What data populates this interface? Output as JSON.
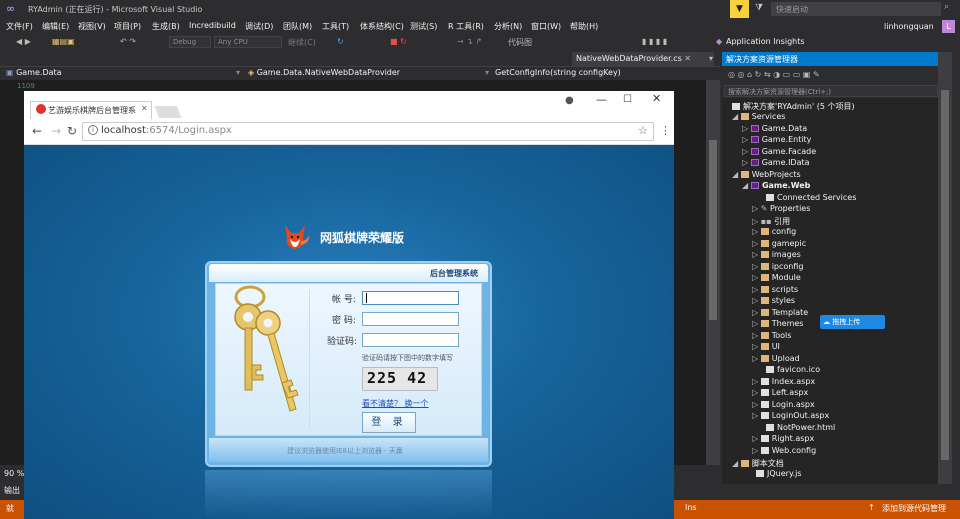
{
  "vs": {
    "title": "RYAdmin (正在运行) - Microsoft Visual Studio",
    "quick_launch_placeholder": "快速启动",
    "user": "linhongquan",
    "avatar_letter": "L",
    "menu": [
      "文件(F)",
      "编辑(E)",
      "视图(V)",
      "项目(P)",
      "生成(B)",
      "Incredibuild",
      "调试(D)",
      "团队(M)",
      "工具(T)",
      "体系结构(C)",
      "测试(S)",
      "R 工具(R)",
      "分析(N)",
      "窗口(W)",
      "帮助(H)"
    ],
    "toolbar": {
      "config": "Debug",
      "platform": "Any CPU",
      "continue": "继续(C)",
      "code_map": "代码图",
      "app_insights": "Application Insights"
    },
    "active_tab": "NativeWebDataProvider.cs",
    "nav": {
      "project": "Game.Data",
      "type": "Game.Data.NativeWebDataProvider",
      "member": "GetConfigInfo(string configKey)"
    },
    "line_number": "1109",
    "zoom": "90 %",
    "output_label": "输出",
    "status": {
      "ins": "Ins",
      "source_control": "添加到源代码管理",
      "left_icon_text": "就"
    }
  },
  "browser": {
    "tab_title": "艺游娱乐棋牌后台管理系",
    "url_host": "localhost",
    "url_rest": ":6574/Login.aspx"
  },
  "login": {
    "logo_text": "网狐棋牌荣耀版",
    "panel_title": "后台管理系统",
    "account_label": "帐  号:",
    "password_label": "密  码:",
    "captcha_label": "验证码:",
    "captcha_hint": "验证码请按下图中的数字填写",
    "captcha_value": "225 42",
    "captcha_link": "看不清楚？ 换一个",
    "login_button": "登 录",
    "footer": "建议浏览器使用IE8以上浏览器 - 天赢"
  },
  "solution_explorer": {
    "title": "解决方案资源管理器",
    "search_placeholder": "搜索解决方案资源管理器(Ctrl+;)",
    "items": [
      {
        "label": "解决方案'RYAdmin' (5 个项目)",
        "indent": 0,
        "kind": "solution"
      },
      {
        "label": "Services",
        "indent": 1,
        "kind": "folder"
      },
      {
        "label": "Game.Data",
        "indent": 2,
        "kind": "project"
      },
      {
        "label": "Game.Entity",
        "indent": 2,
        "kind": "project"
      },
      {
        "label": "Game.Facade",
        "indent": 2,
        "kind": "project"
      },
      {
        "label": "Game.IData",
        "indent": 2,
        "kind": "project"
      },
      {
        "label": "WebProjects",
        "indent": 1,
        "kind": "folder"
      },
      {
        "label": "Game.Web",
        "indent": 2,
        "kind": "project"
      },
      {
        "label": "Connected Services",
        "indent": 3,
        "kind": "file"
      },
      {
        "label": "Properties",
        "indent": 3,
        "kind": "file"
      },
      {
        "label": "引用",
        "indent": 3,
        "kind": "file"
      },
      {
        "label": "config",
        "indent": 3,
        "kind": "folder"
      },
      {
        "label": "gamepic",
        "indent": 3,
        "kind": "folder"
      },
      {
        "label": "images",
        "indent": 3,
        "kind": "folder"
      },
      {
        "label": "ipconfig",
        "indent": 3,
        "kind": "folder"
      },
      {
        "label": "Module",
        "indent": 3,
        "kind": "folder"
      },
      {
        "label": "scripts",
        "indent": 3,
        "kind": "folder"
      },
      {
        "label": "styles",
        "indent": 3,
        "kind": "folder"
      },
      {
        "label": "Template",
        "indent": 3,
        "kind": "folder"
      },
      {
        "label": "Themes",
        "indent": 3,
        "kind": "folder"
      },
      {
        "label": "Tools",
        "indent": 3,
        "kind": "folder"
      },
      {
        "label": "UI",
        "indent": 3,
        "kind": "folder"
      },
      {
        "label": "Upload",
        "indent": 3,
        "kind": "folder"
      },
      {
        "label": "favicon.ico",
        "indent": 3,
        "kind": "file"
      },
      {
        "label": "Index.aspx",
        "indent": 3,
        "kind": "file"
      },
      {
        "label": "Left.aspx",
        "indent": 3,
        "kind": "file"
      },
      {
        "label": "Login.aspx",
        "indent": 3,
        "kind": "file"
      },
      {
        "label": "LoginOut.aspx",
        "indent": 3,
        "kind": "file"
      },
      {
        "label": "NotPower.html",
        "indent": 3,
        "kind": "file"
      },
      {
        "label": "Right.aspx",
        "indent": 3,
        "kind": "file"
      },
      {
        "label": "Web.config",
        "indent": 3,
        "kind": "file"
      },
      {
        "label": "脚本文档",
        "indent": 1,
        "kind": "folder"
      },
      {
        "label": "JQuery.js",
        "indent": 2,
        "kind": "file"
      }
    ],
    "upload_button": "拖拽上传"
  },
  "colors": {
    "accent": "#007acc",
    "status": "#ca5100",
    "page_bg": "#135e91"
  }
}
